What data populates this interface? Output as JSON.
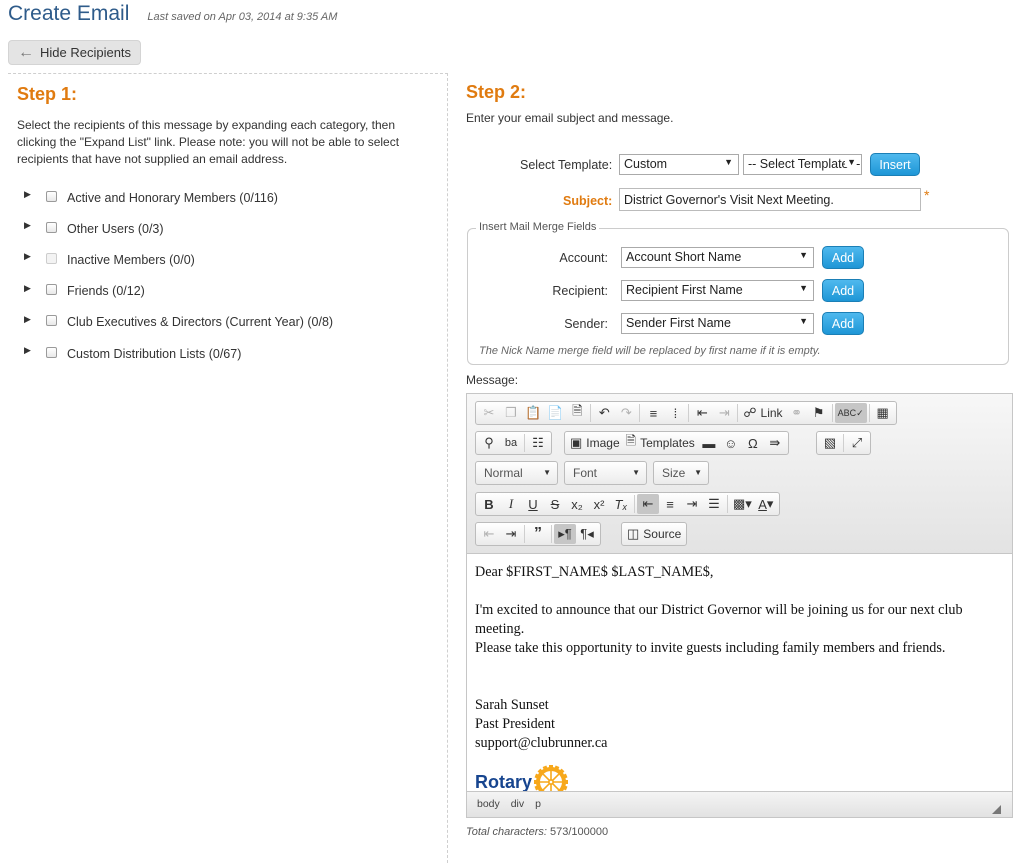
{
  "header": {
    "title": "Create Email",
    "last_saved": "Last saved on Apr 03, 2014 at 9:35 AM"
  },
  "hide_button": {
    "label": "Hide Recipients",
    "icon": "arrow-left-icon"
  },
  "step1": {
    "title": "Step 1:",
    "description": "Select the recipients of this message by expanding each category, then clicking the \"Expand List\" link. Please note: you will not be able to select recipients that have not supplied an email address.",
    "categories": [
      {
        "label": "Active and Honorary Members (0/116)",
        "disabled": false
      },
      {
        "label": "Other Users (0/3)",
        "disabled": false
      },
      {
        "label": "Inactive Members (0/0)",
        "disabled": true
      },
      {
        "label": "Friends (0/12)",
        "disabled": false
      },
      {
        "label": "Club Executives & Directors (Current Year) (0/8)",
        "disabled": false
      },
      {
        "label": "Custom Distribution Lists (0/67)",
        "disabled": false
      }
    ]
  },
  "step2": {
    "title": "Step 2:",
    "description": "Enter your email subject and message.",
    "template": {
      "label": "Select Template:",
      "type_value": "Custom",
      "template_value": "-- Select Template --",
      "insert_label": "Insert"
    },
    "subject": {
      "label": "Subject:",
      "value": "District Governor's Visit Next Meeting.",
      "required_mark": "*"
    },
    "merge": {
      "legend": "Insert Mail Merge Fields",
      "rows": [
        {
          "label": "Account:",
          "value": "Account Short Name",
          "button": "Add"
        },
        {
          "label": "Recipient:",
          "value": "Recipient First Name",
          "button": "Add"
        },
        {
          "label": "Sender:",
          "value": "Sender First Name",
          "button": "Add"
        }
      ],
      "note": "The Nick Name merge field will be replaced by first name if it is empty."
    },
    "message_label": "Message:",
    "toolbar": {
      "link_label": "Link",
      "image_label": "Image",
      "templates_label": "Templates",
      "format_value": "Normal",
      "font_value": "Font",
      "size_value": "Size",
      "source_label": "Source"
    },
    "message": {
      "greeting": "Dear $FIRST_NAME$ $LAST_NAME$,",
      "line1": "I'm excited to announce that our District Governor will be joining us for our next club meeting.",
      "line2": "Please take this opportunity to invite guests including family members and friends.",
      "sig_name": "Sarah Sunset",
      "sig_title": "Past President",
      "sig_email": "support@clubrunner.ca",
      "logo_text": "Rotary"
    },
    "statusbar": {
      "path": [
        "body",
        "div",
        "p"
      ]
    },
    "total": {
      "label": "Total characters:",
      "value": "573/100000"
    }
  },
  "colors": {
    "accent": "#e07b10",
    "title_blue": "#2e5b8a",
    "button_blue": "#1e96d6",
    "rotary_blue": "#17458f",
    "rotary_gold": "#f7a81b"
  }
}
